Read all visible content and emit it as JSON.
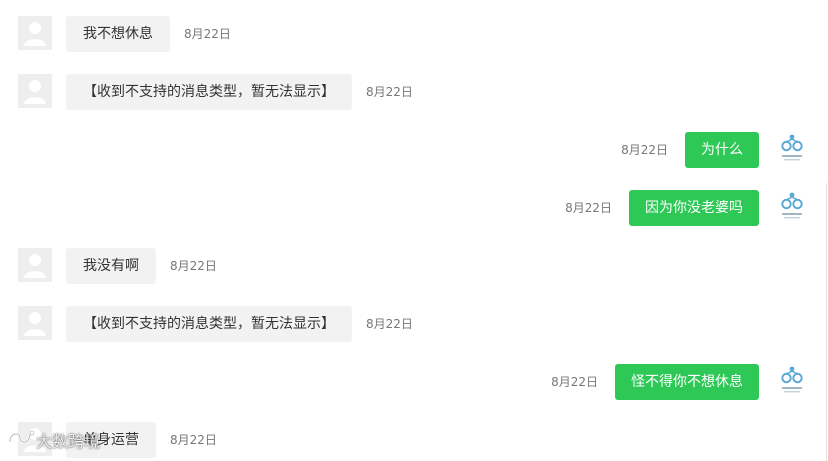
{
  "messages": [
    {
      "side": "in",
      "text": "我不想休息",
      "time": "8月22日"
    },
    {
      "side": "in",
      "text": "【收到不支持的消息类型，暂无法显示】",
      "time": "8月22日"
    },
    {
      "side": "out",
      "text": "为什么",
      "time": "8月22日"
    },
    {
      "side": "out",
      "text": "因为你没老婆吗",
      "time": "8月22日"
    },
    {
      "side": "in",
      "text": "我没有啊",
      "time": "8月22日"
    },
    {
      "side": "in",
      "text": "【收到不支持的消息类型，暂无法显示】",
      "time": "8月22日"
    },
    {
      "side": "out",
      "text": "怪不得你不想休息",
      "time": "8月22日"
    },
    {
      "side": "in",
      "text": "单身运营",
      "time": "8月22日"
    }
  ],
  "watermark": {
    "text": "大数跨境"
  },
  "colors": {
    "incoming_bubble": "#f2f2f2",
    "outgoing_bubble": "#2ec857",
    "timestamp": "#777777",
    "avatar_placeholder": "#eeeeee",
    "brand_logo": "#5aa9d6"
  },
  "icons": {
    "incoming_avatar": "default-user-avatar-icon",
    "outgoing_avatar": "brand-logo-icon"
  }
}
